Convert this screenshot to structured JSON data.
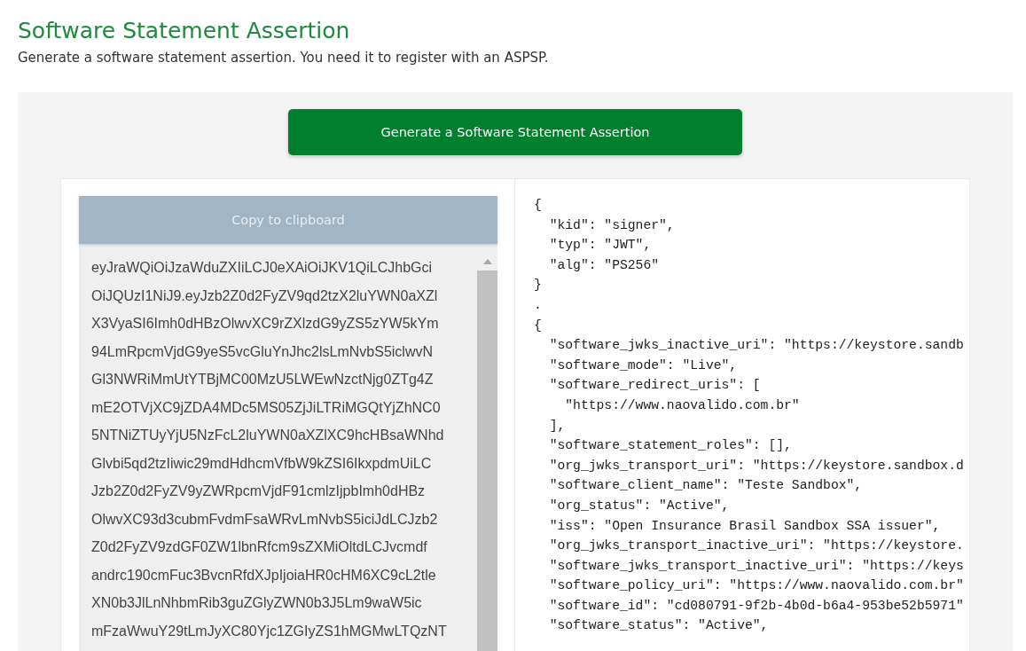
{
  "header": {
    "title": "Software Statement Assertion",
    "subtitle": "Generate a software statement assertion. You need it to register with an ASPSP."
  },
  "generate_button": {
    "label": "Generate a Software Statement Assertion"
  },
  "copy_button": {
    "label": "Copy to clipboard",
    "disabled": true
  },
  "token_lines": [
    "eyJraWQiOiJzaWduZXIiLCJ0eXAiOiJKV1QiLCJhbGci",
    "OiJQUzI1NiJ9.eyJzb2Z0d2FyZV9qd2tzX2luYWN0aXZl",
    "X3VyaSI6Imh0dHBzOlwvXC9rZXlzdG9yZS5zYW5kYm",
    "94LmRpcmVjdG9yeS5vcGluYnJhc2lsLmNvbS5iclwvN",
    "Gl3NWRiMmUtYTBjMC00MzU5LWEwNzctNjg0ZTg4Z",
    "mE2OTVjXC9jZDA4MDc5MS05ZjJiLTRiMGQtYjZhNC0",
    "5NTNiZTUyYjU5NzFcL2luYWN0aXZlXC9hcHBsaWNhd",
    "Glvbi5qd2tzIiwic29mdHdhcmVfbW9kZSI6IkxpdmUiLC",
    "Jzb2Z0d2FyZV9yZWRpcmVjdF91cmlzIjpbImh0dHBz",
    "OlwvXC93d3cubmFvdmFsaWRvLmNvbS5iciJdLCJzb2",
    "Z0d2FyZV9zdGF0ZW1lbnRfcm9sZXMiOltdLCJvcmdf",
    "andrc190cmFuc3BvcnRfdXJpIjoiaHR0cHM6XC9cL2tle",
    "XN0b3JlLnNhbmRib3guZGlyZWN0b3J5Lm9waW5ic",
    "mFzaWwuY29tLmJyXC80Yjc1ZGIyZS1hMGMwLTQzNT"
  ],
  "json_lines": [
    "{",
    "  \"kid\": \"signer\",",
    "  \"typ\": \"JWT\",",
    "  \"alg\": \"PS256\"",
    "}",
    ".",
    "{",
    "  \"software_jwks_inactive_uri\": \"https://keystore.sandb",
    "  \"software_mode\": \"Live\",",
    "  \"software_redirect_uris\": [",
    "    \"https://www.naovalido.com.br\"",
    "  ],",
    "  \"software_statement_roles\": [],",
    "  \"org_jwks_transport_uri\": \"https://keystore.sandbox.d",
    "  \"software_client_name\": \"Teste Sandbox\",",
    "  \"org_status\": \"Active\",",
    "  \"iss\": \"Open Insurance Brasil Sandbox SSA issuer\",",
    "  \"org_jwks_transport_inactive_uri\": \"https://keystore.",
    "  \"software_jwks_transport_inactive_uri\": \"https://keys",
    "  \"software_policy_uri\": \"https://www.naovalido.com.br\"",
    "  \"software_id\": \"cd080791-9f2b-4b0d-b6a4-953be52b5971\"",
    "  \"software_status\": \"Active\","
  ]
}
